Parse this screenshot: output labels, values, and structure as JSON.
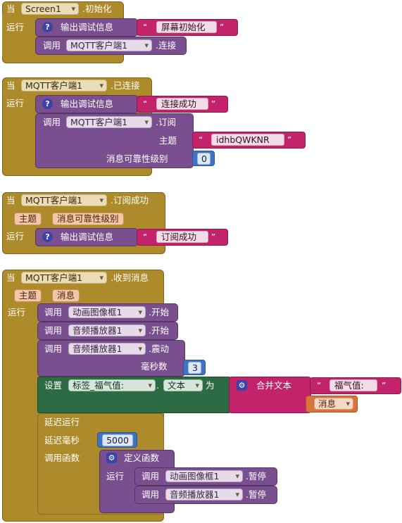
{
  "common": {
    "when": "当",
    "do": "运行",
    "call": "调用",
    "print_debug": "输出调试信息",
    "q_icon": "?",
    "gear_icon": "⚙",
    "open_quote": "“",
    "close_quote": "”"
  },
  "block1": {
    "component": "Screen1",
    "event": ".初始化",
    "debug_text": "屏幕初始化",
    "connect_component": "MQTT客户端1",
    "connect_method": ".连接"
  },
  "block2": {
    "component": "MQTT客户端1",
    "event": ".已连接",
    "debug_text": "连接成功",
    "sub_component": "MQTT客户端1",
    "sub_method": ".订阅",
    "topic_label": "主题",
    "topic_value": "idhbQWKNR",
    "qos_label": "消息可靠性级别",
    "qos_value": "0"
  },
  "block3": {
    "component": "MQTT客户端1",
    "event": ".订阅成功",
    "param1": "主题",
    "param2": "消息可靠性级别",
    "debug_text": "订阅成功"
  },
  "block4": {
    "component": "MQTT客户端1",
    "event": ".收到消息",
    "param1": "主题",
    "param2": "消息",
    "call1_component": "动画图像框1",
    "call1_method": ".开始",
    "call2_component": "音频播放器1",
    "call2_method": ".开始",
    "call3_component": "音频播放器1",
    "call3_method": ".震动",
    "ms_label": "毫秒数",
    "ms_value": "3",
    "set_label": "设置",
    "set_component": "标签_福气值:",
    "dot": ".",
    "set_prop": "文本",
    "to_label": "为",
    "join_label": "合并文本",
    "join_str": "福气值:",
    "msg_var": "消息",
    "delay_label": "延迟运行",
    "delay_ms_label": "延迟毫秒",
    "delay_ms_value": "5000",
    "call_fn_label": "调用函数",
    "define_fn_label": "定义函数",
    "inner_do": "运行",
    "pause1_component": "动画图像框1",
    "pause1_method": ".暂停",
    "pause2_component": "音频播放器1",
    "pause2_method": ".暂停"
  }
}
